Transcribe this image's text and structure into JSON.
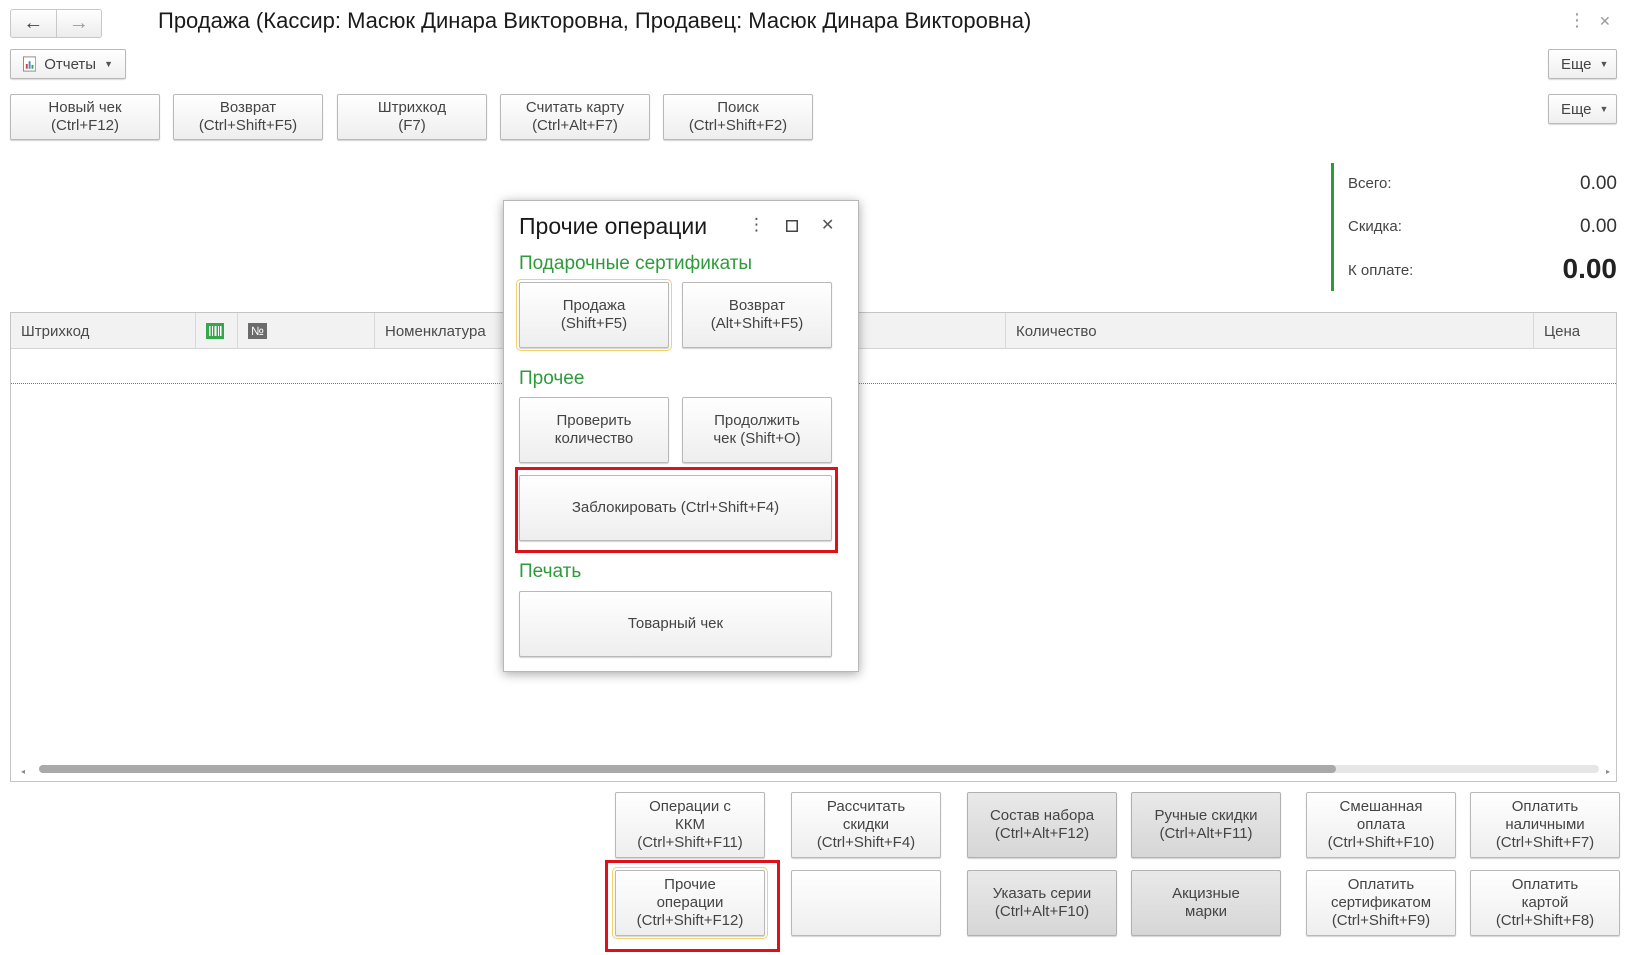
{
  "window": {
    "title": "Продажа (Кассир: Масюк Динара Викторовна, Продавец: Масюк Динара Викторовна)",
    "back_icon": "←",
    "forward_icon": "→",
    "menu_icon": "⋮",
    "close_icon": "✕"
  },
  "toolbar": {
    "reports_label": "Отчеты",
    "more_label": "Еще",
    "more_label_2": "Еще",
    "buttons": [
      {
        "line1": "Новый чек",
        "line2": "(Ctrl+F12)"
      },
      {
        "line1": "Возврат",
        "line2": "(Ctrl+Shift+F5)"
      },
      {
        "line1": "Штрихкод",
        "line2": "(F7)"
      },
      {
        "line1": "Считать карту",
        "line2": "(Ctrl+Alt+F7)"
      },
      {
        "line1": "Поиск",
        "line2": "(Ctrl+Shift+F2)"
      }
    ]
  },
  "totals": {
    "total_label": "Всего:",
    "total_value": "0.00",
    "discount_label": "Скидка:",
    "discount_value": "0.00",
    "to_pay_label": "К оплате:",
    "to_pay_value": "0.00",
    "accent_color": "#2e9b3b"
  },
  "table": {
    "columns": [
      "Штрихкод",
      "",
      "№",
      "Номенклатура",
      "Количество",
      "Цена"
    ]
  },
  "popup": {
    "title": "Прочие операции",
    "sections": {
      "gift": "Подарочные сертификаты",
      "other": "Прочее",
      "print": "Печать"
    },
    "buttons": {
      "sale": {
        "line1": "Продажа",
        "line2": "(Shift+F5)"
      },
      "return": {
        "line1": "Возврат",
        "line2": "(Alt+Shift+F5)"
      },
      "check_qty": {
        "line1": "Проверить",
        "line2": "количество"
      },
      "continue_check": {
        "line1": "Продолжить",
        "line2": "чек (Shift+O)"
      },
      "lock": "Заблокировать (Ctrl+Shift+F4)",
      "receipt": "Товарный чек"
    },
    "highlight_color": "#e0101a"
  },
  "bottom": {
    "row1": [
      {
        "line1": "Операции с",
        "line2": "ККМ",
        "line3": "(Ctrl+Shift+F11)"
      },
      {
        "line1": "Рассчитать",
        "line2": "скидки",
        "line3": "(Ctrl+Shift+F4)"
      },
      {
        "line1": "Состав набора",
        "line2": "(Ctrl+Alt+F12)"
      },
      {
        "line1": "Ручные скидки",
        "line2": "(Ctrl+Alt+F11)"
      },
      {
        "line1": "Смешанная",
        "line2": "оплата",
        "line3": "(Ctrl+Shift+F10)"
      },
      {
        "line1": "Оплатить",
        "line2": "наличными",
        "line3": "(Ctrl+Shift+F7)"
      }
    ],
    "row2": [
      {
        "line1": "Прочие",
        "line2": "операции",
        "line3": "(Ctrl+Shift+F12)"
      },
      {
        "line1": "",
        "line2": ""
      },
      {
        "line1": "Указать серии",
        "line2": "(Ctrl+Alt+F10)"
      },
      {
        "line1": "Акцизные",
        "line2": "марки"
      },
      {
        "line1": "Оплатить",
        "line2": "сертификатом",
        "line3": "(Ctrl+Shift+F9)"
      },
      {
        "line1": "Оплатить",
        "line2": "картой",
        "line3": "(Ctrl+Shift+F8)"
      }
    ]
  }
}
